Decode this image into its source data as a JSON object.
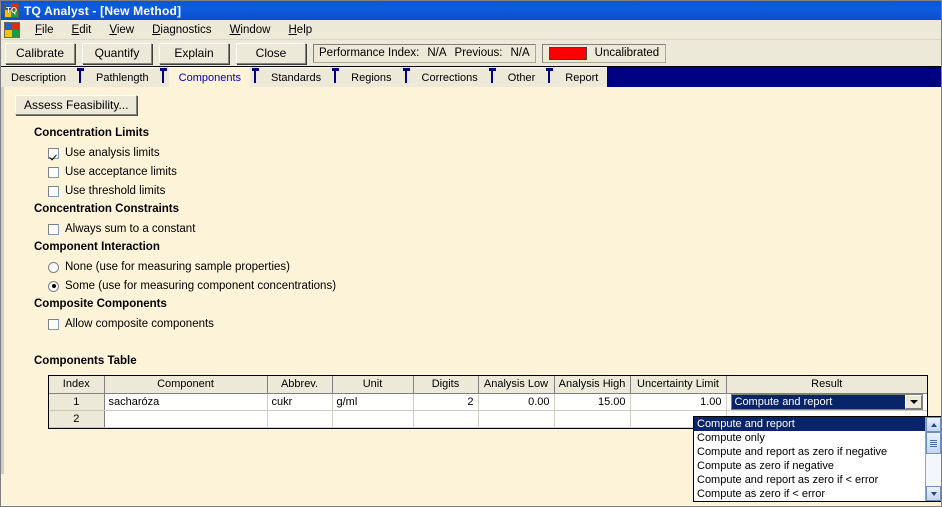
{
  "window": {
    "title": "TQ Analyst  - [New Method]",
    "icon": "tq-logo-icon",
    "app_short": "TQ"
  },
  "menubar": {
    "icon": "tq-document-icon",
    "items": [
      {
        "label": "File",
        "accel": "F"
      },
      {
        "label": "Edit",
        "accel": "E"
      },
      {
        "label": "View",
        "accel": "V"
      },
      {
        "label": "Diagnostics",
        "accel": "D"
      },
      {
        "label": "Window",
        "accel": "W"
      },
      {
        "label": "Help",
        "accel": "H"
      }
    ]
  },
  "toolbar": {
    "buttons": [
      "Calibrate",
      "Quantify",
      "Explain",
      "Close"
    ],
    "performance_label": "Performance Index:",
    "performance_value": "N/A",
    "previous_label": "Previous:",
    "previous_value": "N/A",
    "calibration_status": "Uncalibrated",
    "calibration_color": "#ff0000"
  },
  "tabs": {
    "items": [
      "Description",
      "Pathlength",
      "Components",
      "Standards",
      "Regions",
      "Corrections",
      "Other",
      "Report"
    ],
    "active": "Components"
  },
  "panel": {
    "assess_button": "Assess Feasibility...",
    "groups": [
      {
        "heading": "Concentration Limits",
        "options": [
          {
            "type": "checkbox",
            "label": "Use analysis limits",
            "checked": true
          },
          {
            "type": "checkbox",
            "label": "Use acceptance limits",
            "checked": false
          },
          {
            "type": "checkbox",
            "label": "Use threshold limits",
            "checked": false
          }
        ]
      },
      {
        "heading": "Concentration Constraints",
        "options": [
          {
            "type": "checkbox",
            "label": "Always sum to a constant",
            "checked": false
          }
        ]
      },
      {
        "heading": "Component Interaction",
        "options": [
          {
            "type": "radio",
            "label": "None (use for measuring sample properties)",
            "checked": false
          },
          {
            "type": "radio",
            "label": "Some (use for measuring component concentrations)",
            "checked": true
          }
        ]
      },
      {
        "heading": "Composite Components",
        "options": [
          {
            "type": "checkbox",
            "label": "Allow composite components",
            "checked": false
          }
        ]
      }
    ],
    "table_heading": "Components Table"
  },
  "table": {
    "columns": [
      "Index",
      "Component",
      "Abbrev.",
      "Unit",
      "Digits",
      "Analysis Low",
      "Analysis High",
      "Uncertainty Limit",
      "Result"
    ],
    "rows": [
      {
        "index": "1",
        "component": "sacharóza",
        "abbrev": "cukr",
        "unit": "g/ml",
        "digits": "2",
        "analysis_low": "0.00",
        "analysis_high": "15.00",
        "uncertainty_limit": "1.00",
        "result": "Compute and report"
      },
      {
        "index": "2",
        "component": "",
        "abbrev": "",
        "unit": "",
        "digits": "",
        "analysis_low": "",
        "analysis_high": "",
        "uncertainty_limit": "",
        "result": ""
      }
    ]
  },
  "dropdown": {
    "open": true,
    "selected": "Compute and report",
    "options": [
      "Compute and report",
      "Compute only",
      "Compute and report as zero if negative",
      "Compute as zero if negative",
      "Compute and report as zero if < error",
      "Compute as zero if < error"
    ]
  }
}
